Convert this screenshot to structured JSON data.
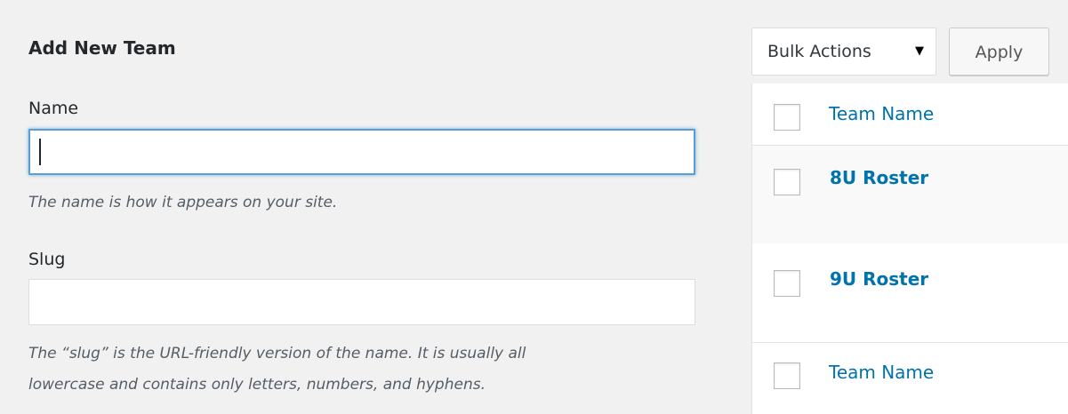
{
  "form": {
    "title": "Add New Team",
    "name_label": "Name",
    "name_value": "",
    "name_description": "The name is how it appears on your site.",
    "slug_label": "Slug",
    "slug_value": "",
    "slug_description_line1": "The “slug” is the URL-friendly version of the name. It is usually all",
    "slug_description_line2": "lowercase and contains only letters, numbers, and hyphens."
  },
  "bulk": {
    "selected": "Bulk Actions",
    "arrow": "▼",
    "apply_label": "Apply"
  },
  "table": {
    "header_label": "Team Name",
    "footer_label": "Team Name",
    "rows": [
      {
        "name": "8U Roster"
      },
      {
        "name": "9U Roster"
      }
    ]
  },
  "colors": {
    "background": "#f1f1f1",
    "link": "#0073aa",
    "focus_border": "#5b9dd9"
  }
}
